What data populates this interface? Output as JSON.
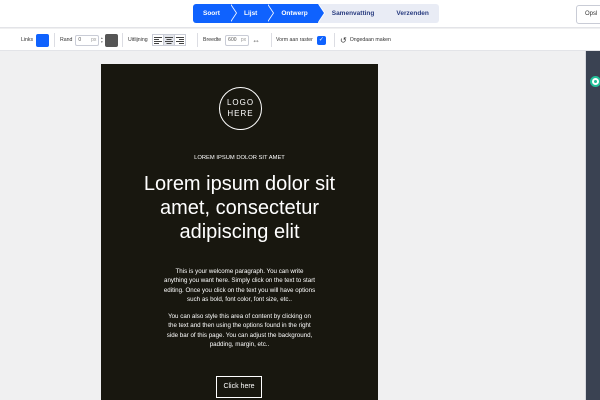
{
  "wizard": {
    "steps": [
      {
        "label": "Soort",
        "state": "done"
      },
      {
        "label": "Lijst",
        "state": "done"
      },
      {
        "label": "Ontwerp",
        "state": "done"
      },
      {
        "label": "Samenvatting",
        "state": "todo"
      },
      {
        "label": "Verzenden",
        "state": "todo"
      }
    ],
    "save_label": "Opsl"
  },
  "toolbar": {
    "links_label": "Links",
    "links_color": "#0f62fe",
    "rand_label": "Rand",
    "rand_value": "0",
    "rand_unit": "px",
    "rand_color": "#555555",
    "alignment_label": "Uitlijning",
    "width_label": "Breedte",
    "width_value": "600",
    "width_unit": "px",
    "fit_label": "Vorm aan raster",
    "undo_label": "Ongedaan maken"
  },
  "email": {
    "logo_line1": "LOGO",
    "logo_line2": "HERE",
    "kicker": "LOREM IPSUM DOLOR SIT AMET",
    "headline": "Lorem ipsum dolor sit amet, consectetur adipiscing elit",
    "paragraph1": "This is your welcome paragraph. You can write anything you want here. Simply click on the text to start editing. Once you click on the text you will have options such as bold, font color, font size, etc..",
    "paragraph2": "You can also style this area of content by clicking on the text and then using the options found in the right side bar of this page. You can adjust the background, padding, margin, etc..",
    "cta_label": "Click here"
  },
  "colors": {
    "accent": "#0f62fe",
    "email_background": "#18170f",
    "status_green": "#23c09a"
  }
}
